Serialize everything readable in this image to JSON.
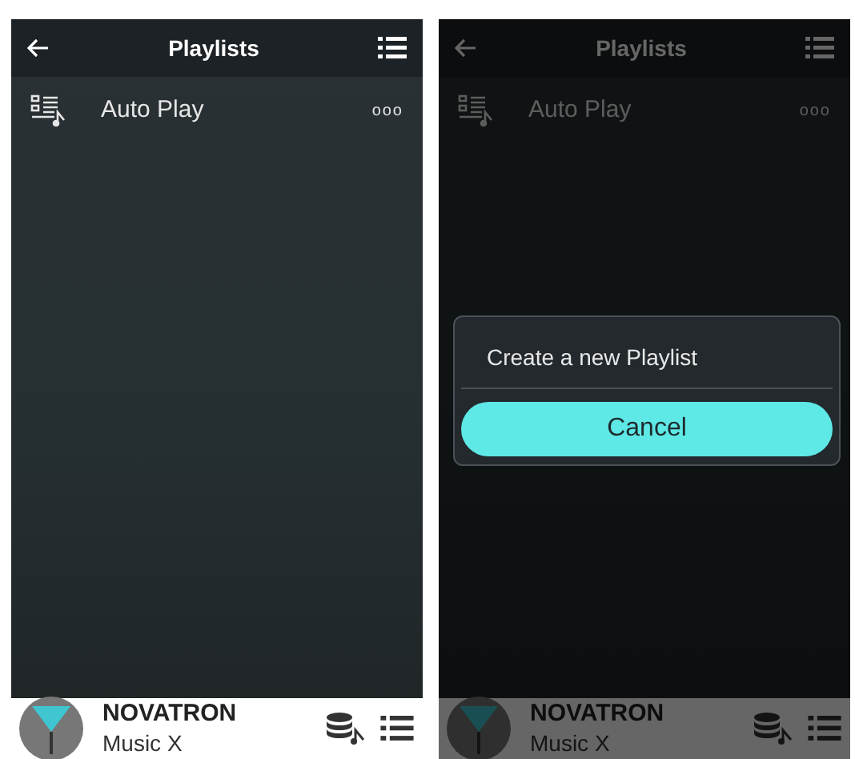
{
  "screens": [
    {
      "header": {
        "title": "Playlists"
      },
      "playlists": [
        {
          "label": "Auto Play",
          "more": "ooo"
        }
      ],
      "player": {
        "artist": "NOVATRON",
        "title": "Music X"
      },
      "dimmed": false
    },
    {
      "header": {
        "title": "Playlists"
      },
      "playlists": [
        {
          "label": "Auto Play",
          "more": "ooo"
        }
      ],
      "player": {
        "artist": "NOVATRON",
        "title": "Music X"
      },
      "dimmed": true,
      "dialog": {
        "option": "Create a new Playlist",
        "button": "Cancel"
      }
    }
  ]
}
